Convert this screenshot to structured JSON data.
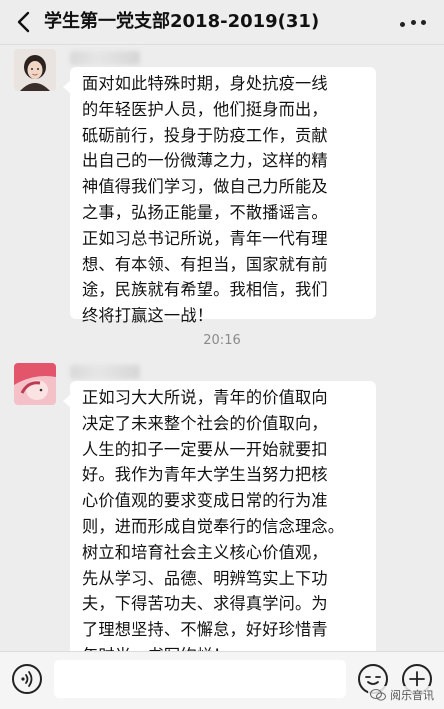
{
  "header": {
    "title": "学生第一党支部2018-2019(31)"
  },
  "messages": [
    {
      "lines": [
        "面对如此特殊时期，身处抗疫一线",
        "的年轻医护人员，他们挺身而出，",
        "砥砺前行，投身于防疫工作，贡献",
        "出自己的一份微薄之力，这样的精",
        "神值得我们学习，做自己力所能及",
        "之事，弘扬正能量，不散播谣言。",
        "正如习总书记所说，青年一代有理",
        "想、有本领、有担当，国家就有前",
        "途，民族就有希望。我相信，我们",
        "终将打赢这一战！"
      ]
    },
    {
      "lines": [
        "正如习大大所说，青年的价值取向",
        "决定了未来整个社会的价值取向，",
        "人生的扣子一定要从一开始就要扣",
        "好。我作为青年大学生当努力把核",
        "心价值观的要求变成日常的行为准",
        "则，进而形成自觉奉行的信念理念。",
        "树立和培育社会主义核心价值观，",
        "先从学习、品德、明辨笃实上下功",
        "夫，下得苦功夫、求得真学问。为",
        "了理想坚持、不懈怠，好好珍惜青",
        "年时光，书写绚烂！"
      ]
    }
  ],
  "timestamp": "20:16",
  "watermark": {
    "text": "阅乐音讯"
  },
  "icons": {
    "back": "chevron-left-icon",
    "more": "more-dots-icon",
    "voice": "voice-icon",
    "emoji": "emoji-icon",
    "plus": "plus-icon"
  },
  "colors": {
    "background": "#ededed",
    "bubble": "#ffffff",
    "input_bar": "#f5f5f5"
  }
}
